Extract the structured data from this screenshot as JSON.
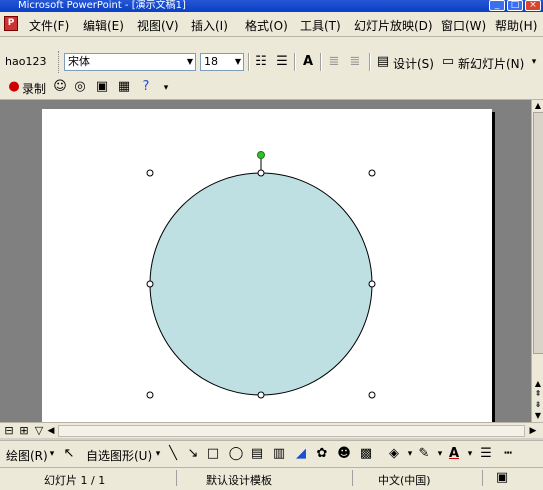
{
  "window": {
    "title": "Microsoft PowerPoint - [演示文稿1]"
  },
  "menubar": {
    "items": [
      "文件(F)",
      "编辑(E)",
      "视图(V)",
      "插入(I)",
      "格式(O)",
      "工具(T)",
      "幻灯片放映(D)",
      "窗口(W)",
      "帮助(H)"
    ]
  },
  "formatting_toolbar": {
    "hao123_label": "hao123",
    "font_name": "宋体",
    "font_size": "18",
    "design_label": "设计(S)",
    "new_slide_label": "新幻灯片(N)"
  },
  "record_toolbar": {
    "record_label": "录制"
  },
  "drawing_toolbar": {
    "draw_label": "绘图(R)",
    "autoshapes_label": "自选图形(U)"
  },
  "statusbar": {
    "slide_position": "幻灯片 1 / 1",
    "design_template": "默认设计模板",
    "language": "中文(中国)"
  },
  "slide": {
    "shape": "circle",
    "shape_fill": "#bfe0e3",
    "shape_outline": "#000000",
    "rotate_handle_color": "#2fbf2f"
  },
  "colors": {
    "titlebar": "#0a3fc4",
    "chrome": "#ece9d8",
    "workspace": "#808080"
  }
}
